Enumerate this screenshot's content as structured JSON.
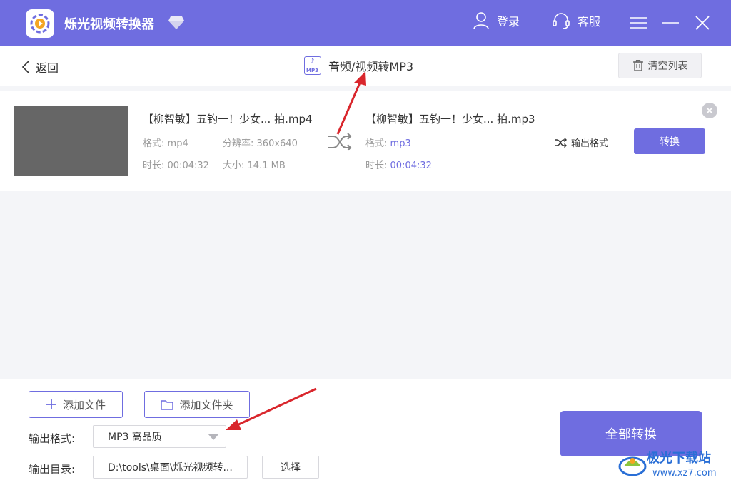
{
  "header": {
    "app_title": "烁光视频转换器",
    "login_label": "登录",
    "support_label": "客服"
  },
  "subheader": {
    "back_label": "返回",
    "page_title": "音频/视频转MP3",
    "mp3_icon_text": "MP3",
    "clear_list_label": "清空列表"
  },
  "file": {
    "source_name": "【柳智敏】五钓一！少女... 拍.mp4",
    "source_format_label": "格式:",
    "source_format": "mp4",
    "resolution_label": "分辨率:",
    "resolution": "360x640",
    "source_duration_label": "时长:",
    "source_duration": "00:04:32",
    "size_label": "大小:",
    "size": "14.1 MB",
    "target_name": "【柳智敏】五钓一！少女... 拍.mp3",
    "target_format_label": "格式:",
    "target_format": "mp3",
    "target_duration_label": "时长:",
    "target_duration": "00:04:32",
    "output_format_label": "输出格式",
    "convert_label": "转换"
  },
  "bottom": {
    "add_file_label": "添加文件",
    "add_folder_label": "添加文件夹",
    "output_format_label": "输出格式:",
    "output_format_value": "MP3 高品质",
    "output_dir_label": "输出目录:",
    "output_dir_value": "D:\\tools\\桌面\\烁光视频转...",
    "choose_label": "选择",
    "convert_all_label": "全部转换"
  },
  "watermark": {
    "text": "极光下载站",
    "url": "www.xz7.com"
  },
  "colors": {
    "accent": "#6f6de0",
    "arrow": "#d9262c"
  }
}
